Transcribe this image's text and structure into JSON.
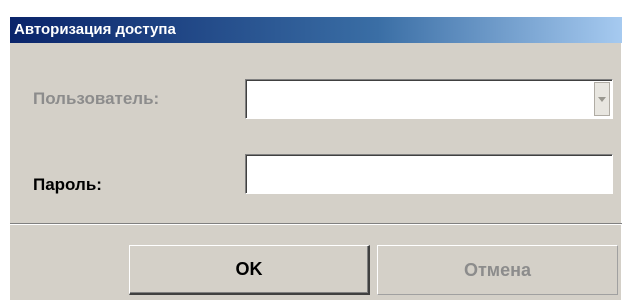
{
  "window": {
    "title": "Авторизация доступа"
  },
  "form": {
    "user_label": "Пользователь:",
    "user_value": "",
    "password_label": "Пароль:",
    "password_value": ""
  },
  "buttons": {
    "ok_label": "OK",
    "cancel_label": "Отмена"
  },
  "icons": {
    "dropdown": "chevron-down-icon"
  },
  "colors": {
    "titlebar_start": "#0a246a",
    "titlebar_end": "#a6caf0",
    "dialog_bg": "#d4d0c8",
    "disabled_text": "#8c8c8c"
  }
}
